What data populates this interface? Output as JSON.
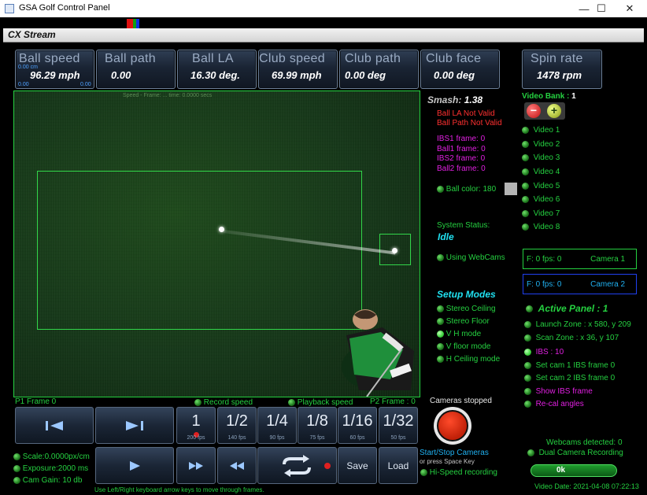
{
  "window": {
    "title": "GSA Golf Control Panel",
    "minimize": "—",
    "maximize": "☐",
    "close": "✕"
  },
  "stream": {
    "title": "CX Stream"
  },
  "metrics": [
    {
      "id": "ball-speed",
      "label": "Ball speed",
      "value": "96.29 mph"
    },
    {
      "id": "ball-path",
      "label": "Ball path",
      "value": "0.00"
    },
    {
      "id": "ball-la",
      "label": "Ball LA",
      "value": "16.30 deg."
    },
    {
      "id": "club-speed",
      "label": "Club speed",
      "value": "69.99 mph"
    },
    {
      "id": "club-path",
      "label": "Club path",
      "value": "0.00 deg"
    },
    {
      "id": "club-face",
      "label": "Club face",
      "value": "0.00 deg"
    }
  ],
  "ball_speed_small": {
    "cm": "0.00 cm",
    "left": "0.00",
    "right": "0.00"
  },
  "spin": {
    "label": "Spin rate",
    "value": "1478 rpm"
  },
  "video": {
    "header": "Speed - Frame: ... time: 0.0000 secs"
  },
  "info": {
    "smash_label": "Smash:",
    "smash_value": "1.38",
    "ball_la_invalid": "Ball LA Not Valid",
    "ball_path_invalid": "Ball Path Not Valid",
    "ibs1": "IBS1 frame: 0",
    "ball1": "Ball1 frame: 0",
    "ibs2": "IBS2 frame: 0",
    "ball2": "Ball2 frame: 0",
    "ball_color": "Ball color: 180",
    "system_status_label": "System Status:",
    "system_status": "Idle",
    "using_webcams": "Using WebCams"
  },
  "setup": {
    "title": "Setup Modes",
    "modes": [
      "Stereo Ceiling",
      "Stereo Floor",
      "V H mode",
      "V floor mode",
      "H Ceiling mode"
    ]
  },
  "video_bank": {
    "label": "Video Bank :",
    "value": "1",
    "minus": "−",
    "plus": "+",
    "videos": [
      "Video 1",
      "Video 2",
      "Video 3",
      "Video 4",
      "Video 5",
      "Video 6",
      "Video 7",
      "Video 8"
    ]
  },
  "cameras": [
    {
      "fps": "F: 0 fps: 0",
      "name": "Camera 1"
    },
    {
      "fps": "F: 0 fps: 0",
      "name": "Camera 2"
    }
  ],
  "active_panel": {
    "title": "Active Panel : 1",
    "items": [
      "Launch Zone : x 580, y 209",
      "Scan Zone : x 36, y 107",
      "IBS : 10",
      "Set cam 1 IBS frame 0",
      "Set cam 2 IBS frame 0",
      "Show IBS frame",
      "Re-cal angles"
    ]
  },
  "frames": {
    "p1": "P1 Frame   0",
    "p2": "P2 Frame : 0",
    "record_speed": "Record speed",
    "playback_speed": "Playback speed"
  },
  "speeds": [
    {
      "label": "1",
      "fps": "200 fps"
    },
    {
      "label": "1/2",
      "fps": "140 fps"
    },
    {
      "label": "1/4",
      "fps": "90 fps"
    },
    {
      "label": "1/8",
      "fps": "75 fps"
    },
    {
      "label": "1/16",
      "fps": "60 fps"
    },
    {
      "label": "1/32",
      "fps": "50 fps"
    }
  ],
  "bottom_left": {
    "scale": "Scale:0.0000px/cm",
    "exposure": "Exposure:2000 ms",
    "gain": "Cam Gain: 10 db"
  },
  "buttons": {
    "save": "Save",
    "load": "Load"
  },
  "hint": "Use Left/Right keyboard arrow keys to move through frames.",
  "cam_control": {
    "status": "Cameras stopped",
    "start_stop": "Start/Stop Cameras",
    "space_hint": "or press Space Key",
    "hi_speed": "Hi-Speed recording"
  },
  "webcams": {
    "detected": "Webcams detected: 0",
    "dual": "Dual Camera Recording",
    "ok": "0k",
    "video_date": "Video Date: 2021-04-08 07:22:13"
  },
  "colors": {
    "accent_green": "#25d040",
    "red_text": "#ff3030",
    "magenta_text": "#e020e0",
    "cyan_text": "#20e0f0",
    "panel_blue": "#1a2434"
  }
}
